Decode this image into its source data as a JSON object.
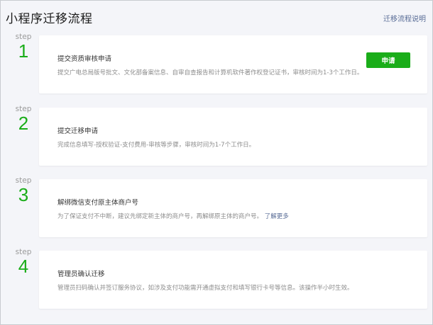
{
  "page": {
    "title": "小程序迁移流程",
    "help_link": "迁移流程说明"
  },
  "steps": [
    {
      "label": "step",
      "number": "1",
      "title": "提交资质审核申请",
      "description": "提交广电总局版号批文、文化部备案信息、自审自查报告和计算机软件著作权登记证书，审核时间为1-3个工作日。",
      "button": "申请"
    },
    {
      "label": "step",
      "number": "2",
      "title": "提交迁移申请",
      "description": "完成信息填写-授权验证-支付费用-审核等步骤，审核时间为1-7个工作日。"
    },
    {
      "label": "step",
      "number": "3",
      "title": "解绑微信支付原主体商户号",
      "description": "为了保证支付不中断，建议先绑定新主体的商户号，再解绑原主体的商户号。",
      "link": "了解更多"
    },
    {
      "label": "step",
      "number": "4",
      "title": "管理员确认迁移",
      "description": "管理员扫码确认并签订服务协议，如涉及支付功能需开通虚拟支付和填写银行卡号等信息。该操作半小时生效。"
    }
  ],
  "colors": {
    "accent": "#1aad19",
    "link": "#576b95",
    "background": "#f4f5f9"
  }
}
